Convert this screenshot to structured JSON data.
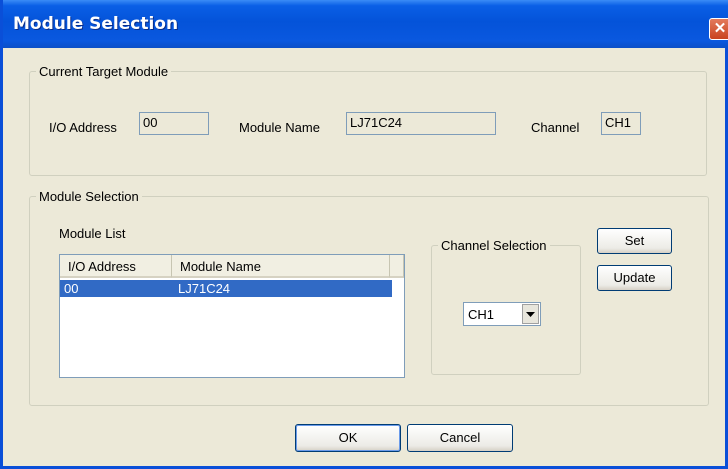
{
  "window": {
    "title": "Module Selection",
    "close_glyph": "✕"
  },
  "current_target": {
    "legend": "Current Target Module",
    "io_address_label": "I/O Address",
    "io_address_value": "00",
    "module_name_label": "Module Name",
    "module_name_value": "LJ71C24",
    "channel_label": "Channel",
    "channel_value": "CH1"
  },
  "module_selection": {
    "legend": "Module Selection",
    "list_label": "Module List",
    "columns": [
      "I/O Address",
      "Module Name"
    ],
    "rows": [
      {
        "io_address": "00",
        "module_name": "LJ71C24",
        "selected": true
      }
    ],
    "channel_group": {
      "legend": "Channel Selection",
      "selected": "CH1"
    },
    "set_label": "Set",
    "update_label": "Update"
  },
  "footer": {
    "ok_label": "OK",
    "cancel_label": "Cancel"
  },
  "colors": {
    "title_bar": "#0453d9",
    "selection": "#316ac5",
    "dialog_bg": "#ece9d8"
  }
}
